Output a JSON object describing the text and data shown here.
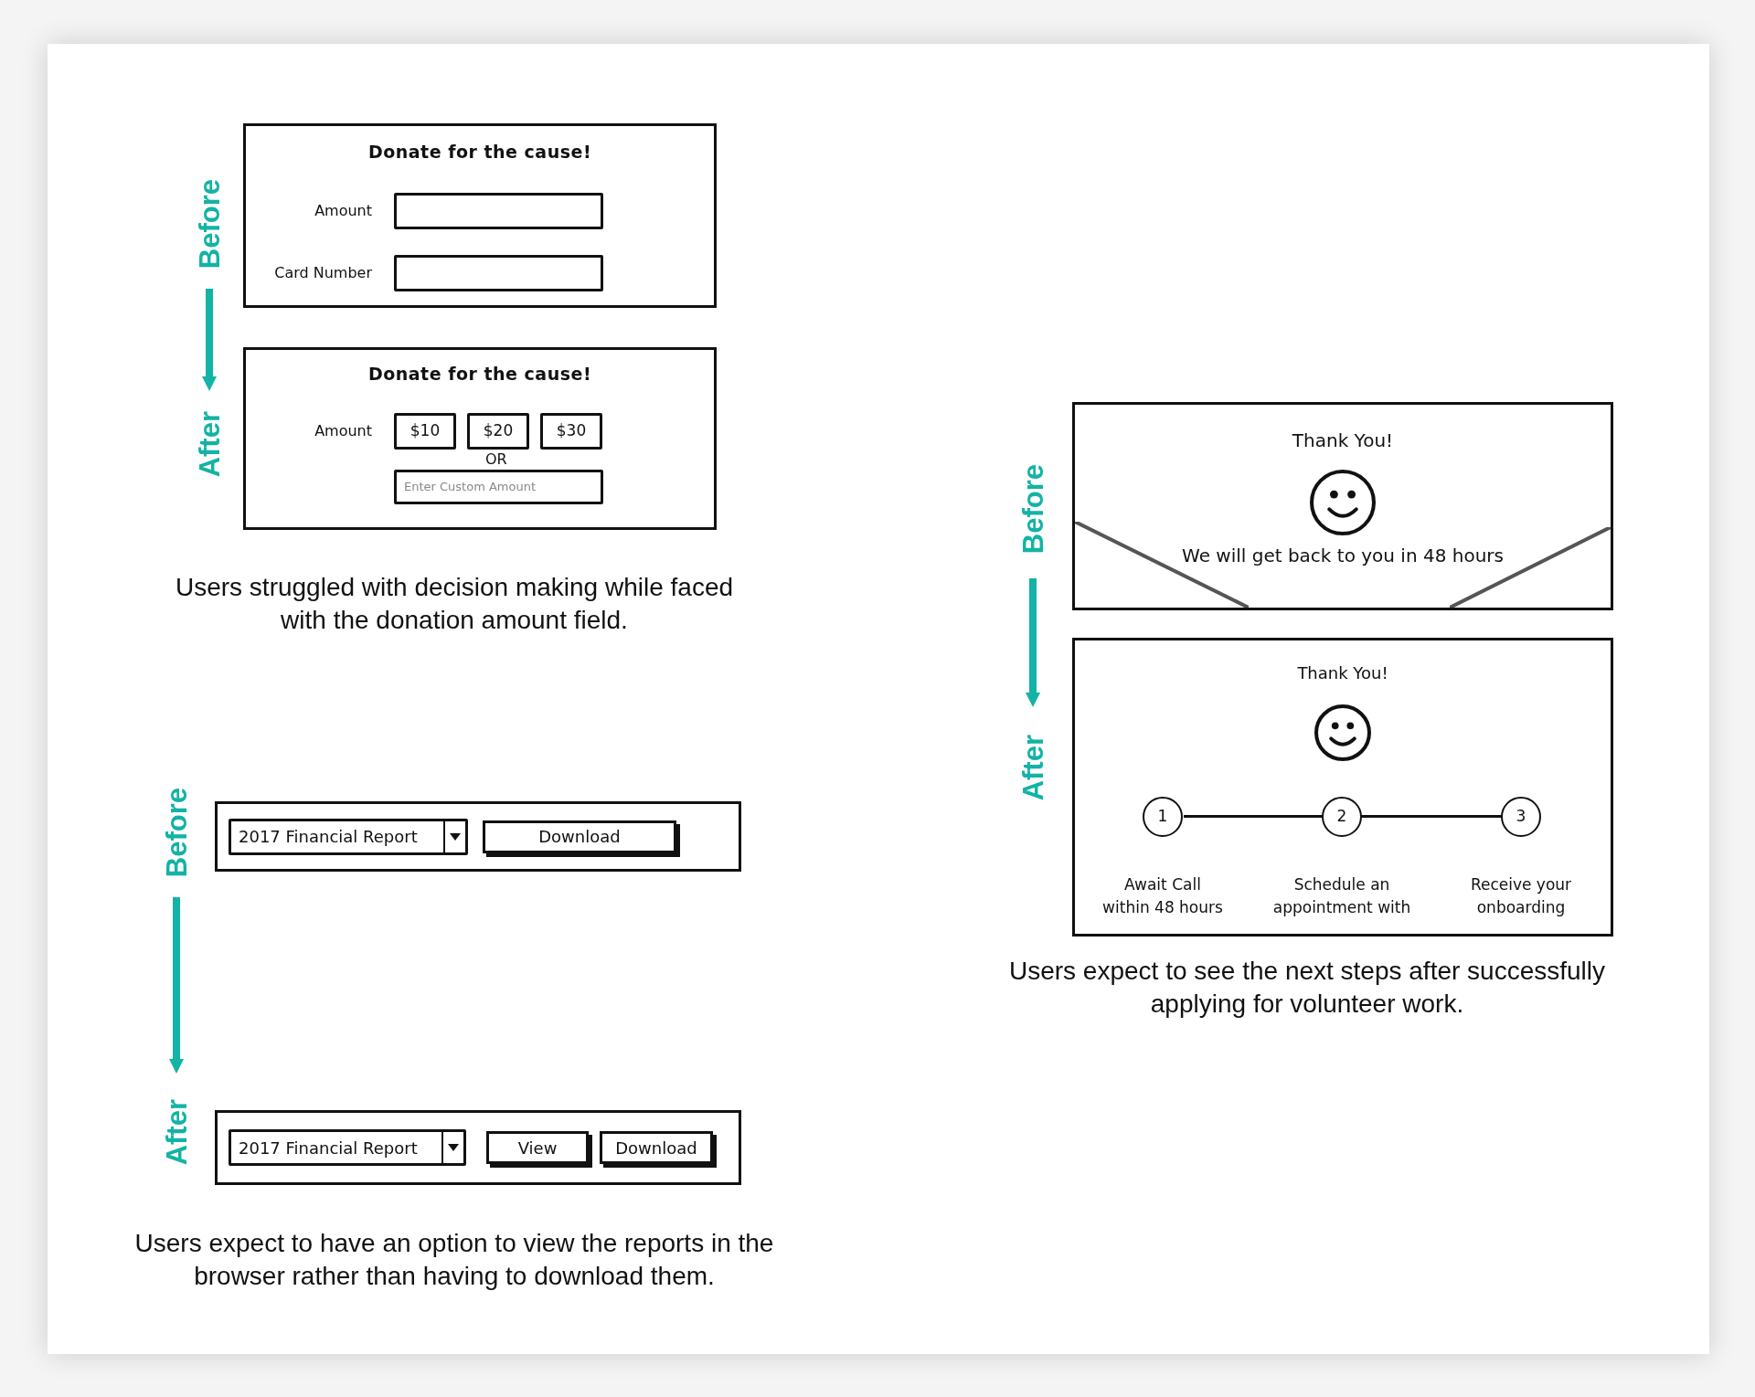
{
  "donation": {
    "before_label": "Before",
    "after_label": "After",
    "before": {
      "title": "Donate for the cause!",
      "fields": [
        {
          "label": "Amount"
        },
        {
          "label": "Card Number"
        }
      ]
    },
    "after": {
      "title": "Donate for the cause!",
      "amount_label": "Amount",
      "amount_options": [
        "$10",
        "$20",
        "$30"
      ],
      "or_text": "OR",
      "custom_placeholder": "Enter Custom Amount"
    },
    "caption": "Users struggled with decision making while faced\nwith the donation amount field."
  },
  "report": {
    "before_label": "Before",
    "after_label": "After",
    "before": {
      "select_value": "2017 Financial Report",
      "buttons": [
        "Download"
      ]
    },
    "after": {
      "select_value": "2017 Financial Report",
      "buttons": [
        "View",
        "Download"
      ]
    },
    "caption": "Users expect to have an option to view the reports in the\nbrowser rather than having to download them."
  },
  "confirmation": {
    "before_label": "Before",
    "after_label": "After",
    "before": {
      "title": "Thank You!",
      "message": "We will get back to you in 48 hours"
    },
    "after": {
      "title": "Thank You!",
      "steps": [
        {
          "number": "1",
          "label": "Await Call\nwithin 48 hours"
        },
        {
          "number": "2",
          "label": "Schedule an\nappointment with"
        },
        {
          "number": "3",
          "label": "Receive your\nonboarding"
        }
      ]
    },
    "caption": "Users expect to see the next steps after successfully\napplying for volunteer work."
  }
}
